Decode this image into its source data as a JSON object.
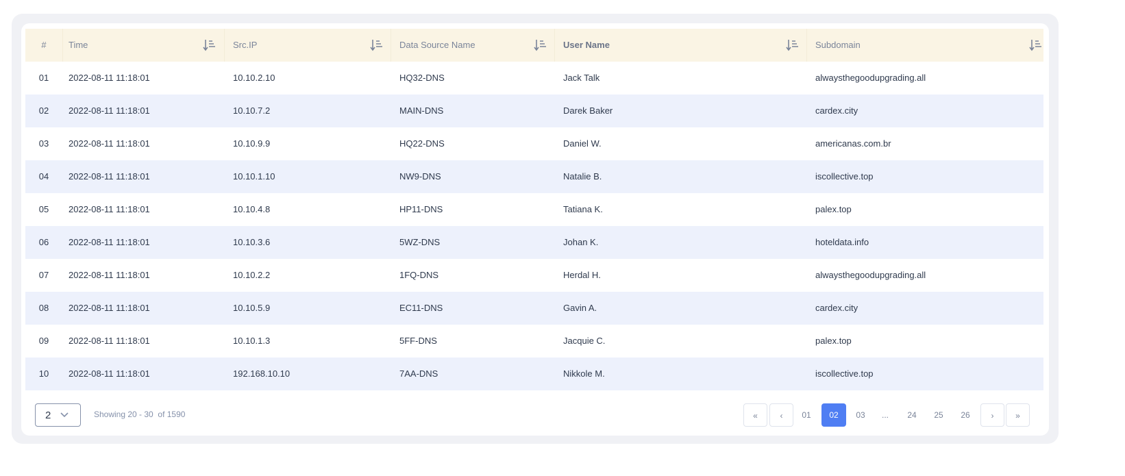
{
  "table": {
    "headers": [
      "#",
      "Time",
      "Src.IP",
      "Data Source Name",
      "User Name",
      "Subdomain"
    ],
    "rows": [
      [
        "01",
        "2022-08-11 11:18:01",
        "10.10.2.10",
        "HQ32-DNS",
        "Jack Talk",
        "alwaysthegoodupgrading.all"
      ],
      [
        "02",
        "2022-08-11 11:18:01",
        "10.10.7.2",
        "MAIN-DNS",
        "Darek Baker",
        "cardex.city"
      ],
      [
        "03",
        "2022-08-11 11:18:01",
        "10.10.9.9",
        "HQ22-DNS",
        "Daniel W.",
        "americanas.com.br"
      ],
      [
        "04",
        "2022-08-11 11:18:01",
        "10.10.1.10",
        "NW9-DNS",
        "Natalie B.",
        "iscollective.top"
      ],
      [
        "05",
        "2022-08-11 11:18:01",
        "10.10.4.8",
        "HP11-DNS",
        "Tatiana K.",
        "palex.top"
      ],
      [
        "06",
        "2022-08-11 11:18:01",
        "10.10.3.6",
        "5WZ-DNS",
        "Johan K.",
        "hoteldata.info"
      ],
      [
        "07",
        "2022-08-11 11:18:01",
        "10.10.2.2",
        "1FQ-DNS",
        "Herdal H.",
        "alwaysthegoodupgrading.all"
      ],
      [
        "08",
        "2022-08-11 11:18:01",
        "10.10.5.9",
        "EC11-DNS",
        "Gavin A.",
        "cardex.city"
      ],
      [
        "09",
        "2022-08-11 11:18:01",
        "10.10.1.3",
        "5FF-DNS",
        "Jacquie C.",
        "palex.top"
      ],
      [
        "10",
        "2022-08-11 11:18:01",
        "192.168.10.10",
        "7AA-DNS",
        "Nikkole M.",
        "iscollective.top"
      ]
    ]
  },
  "footer": {
    "page_size": "2",
    "showing": "Showing 20 - 30  of 1590",
    "pages": [
      {
        "label": "01"
      },
      {
        "label": "02",
        "active": true
      },
      {
        "label": "03"
      },
      {
        "label": "..."
      },
      {
        "label": "24"
      },
      {
        "label": "25"
      },
      {
        "label": "26"
      }
    ],
    "first": "«",
    "prev": "‹",
    "next": "›",
    "last": "»"
  },
  "colors": {
    "header_bg": "#faf4e4",
    "alt_row": "#edf1fc",
    "accent": "#4f7ef3"
  }
}
